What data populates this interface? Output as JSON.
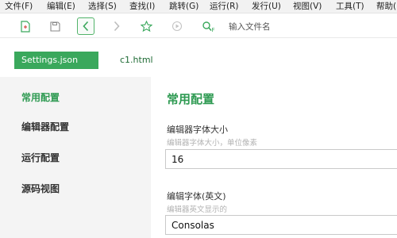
{
  "menu": {
    "items": [
      {
        "label": "文件(F)"
      },
      {
        "label": "编辑(E)"
      },
      {
        "label": "选择(S)"
      },
      {
        "label": "查找(I)"
      },
      {
        "label": "跳转(G)"
      },
      {
        "label": "运行(R)"
      },
      {
        "label": "发行(U)"
      },
      {
        "label": "视图(V)"
      },
      {
        "label": "工具(T)"
      },
      {
        "label": "帮助("
      }
    ]
  },
  "toolbar": {
    "buttons": [
      {
        "icon": "new-file-icon"
      },
      {
        "icon": "save-icon"
      },
      {
        "icon": "back-icon"
      },
      {
        "icon": "forward-icon"
      },
      {
        "icon": "star-icon"
      },
      {
        "icon": "preview-icon"
      }
    ],
    "search": {
      "icon": "search-file-icon",
      "placeholder": "输入文件名"
    },
    "accent_color": "#52b36a"
  },
  "tabs": [
    {
      "label": "Settings.json",
      "active": true
    },
    {
      "label": "c1.html",
      "active": false
    }
  ],
  "sidebar": {
    "items": [
      {
        "label": "常用配置",
        "active": true
      },
      {
        "label": "编辑器配置",
        "active": false
      },
      {
        "label": "运行配置",
        "active": false
      },
      {
        "label": "源码视图",
        "active": false
      }
    ]
  },
  "main": {
    "section_title": "常用配置",
    "fields": [
      {
        "label": "编辑器字体大小",
        "help": "编辑器字体大小，单位像素",
        "value": "16"
      },
      {
        "label": "编辑字体(英文)",
        "help": "编辑器英文显示的",
        "value": "Consolas"
      }
    ]
  },
  "colors": {
    "brand_green": "#3aa85c",
    "title_green": "#2e9a52",
    "sidebar_bg": "#f4f4f4"
  }
}
